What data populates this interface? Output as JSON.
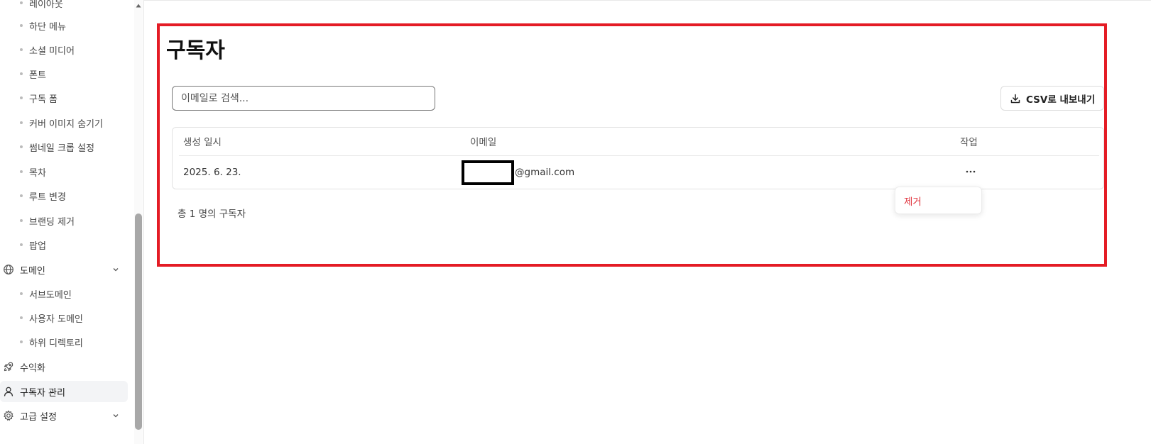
{
  "sidebar": {
    "partial_top_item": "레이아웃",
    "design_sub_items": [
      "하단 메뉴",
      "소셜 미디어",
      "폰트",
      "구독 폼",
      "커버 이미지 숨기기",
      "썸네일 크롭 설정",
      "목차",
      "루트 변경",
      "브랜딩 제거",
      "팝업"
    ],
    "domain": {
      "label": "도메인",
      "icon": "globe-icon"
    },
    "domain_sub_items": [
      "서브도메인",
      "사용자 도메인",
      "하위 디렉토리"
    ],
    "monetize": {
      "label": "수익화",
      "icon": "rocket-icon"
    },
    "subscribers": {
      "label": "구독자 관리",
      "icon": "user-icon",
      "active": true
    },
    "advanced": {
      "label": "고급 설정",
      "icon": "gear-icon"
    }
  },
  "main": {
    "title": "구독자",
    "search": {
      "placeholder": "이메일로 검색...",
      "value": ""
    },
    "export_button": {
      "label": "CSV로 내보내기",
      "icon": "download-icon"
    },
    "table": {
      "headers": {
        "created": "생성 일시",
        "email": "이메일",
        "actions": "작업"
      },
      "rows": [
        {
          "created": "2025. 6. 23.",
          "email_visible_part": "@gmail.com",
          "email_redacted": true
        }
      ]
    },
    "row_menu": {
      "icon": "more-horizontal-icon",
      "items": [
        "제거"
      ]
    },
    "total_text": "총 1 명의 구독자"
  },
  "colors": {
    "annotation_frame": "#e41c25",
    "danger_text": "#e0323c",
    "active_nav_bg": "#f3f4f6"
  }
}
